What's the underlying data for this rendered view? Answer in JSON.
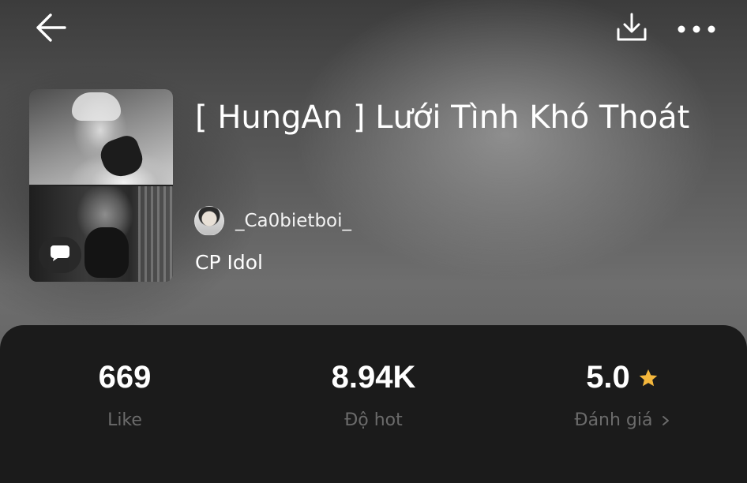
{
  "header": {
    "back_icon": "arrow-left-icon",
    "download_icon": "download-icon",
    "more_icon": "more-horizontal-icon"
  },
  "story": {
    "title": "[ HungAn ] Lưới Tình Khó Thoát",
    "author": "_Ca0bietboi_",
    "category": "CP Idol",
    "comment_icon": "comment-bubble-icon"
  },
  "stats": {
    "likes": {
      "value": "669",
      "label": "Like"
    },
    "hot": {
      "value": "8.94K",
      "label": "Độ hot"
    },
    "rating": {
      "value": "5.0",
      "label": "Đánh giá",
      "star_color": "#f4b73c"
    }
  },
  "colors": {
    "panel_bg": "#1b1b1b",
    "label_gray": "#6b6b6b",
    "star": "#f4b73c"
  }
}
